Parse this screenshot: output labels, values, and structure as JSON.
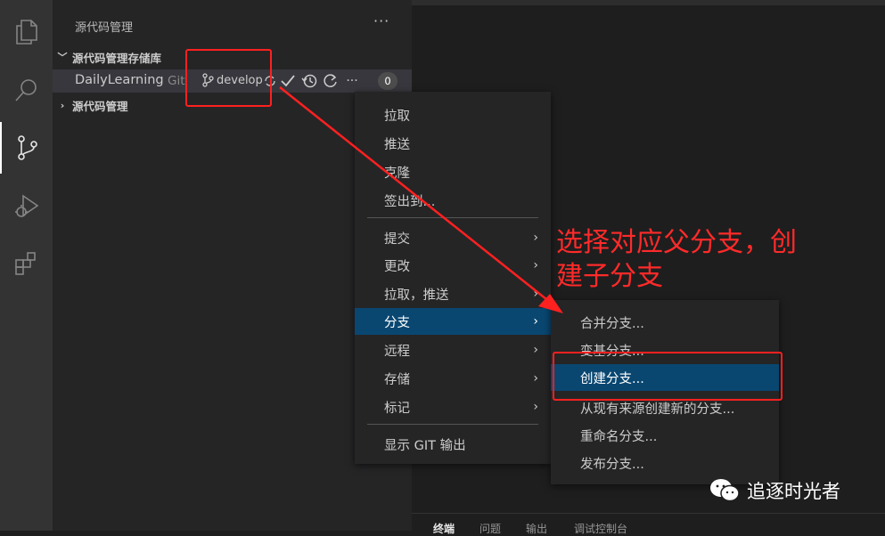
{
  "sidebar": {
    "title": "源代码管理",
    "more_label": "···",
    "section_repos": "源代码管理存储库",
    "section_scm": "源代码管理",
    "repo": {
      "name": "DailyLearning",
      "kind": "Git",
      "branch": "develop",
      "badge": "0",
      "actions_more": "···"
    }
  },
  "context_menu": {
    "items": [
      {
        "label": "拉取"
      },
      {
        "label": "推送"
      },
      {
        "label": "克隆"
      },
      {
        "label": "签出到..."
      },
      {
        "label": "提交",
        "submenu": true
      },
      {
        "label": "更改",
        "submenu": true
      },
      {
        "label": "拉取，推送",
        "submenu": true
      },
      {
        "label": "分支",
        "submenu": true,
        "highlighted": true
      },
      {
        "label": "远程",
        "submenu": true
      },
      {
        "label": "存储",
        "submenu": true
      },
      {
        "label": "标记",
        "submenu": true
      },
      {
        "label": "显示 GIT 输出"
      }
    ],
    "submenu_arrow": "›"
  },
  "branch_submenu": {
    "items": [
      {
        "label": "合并分支..."
      },
      {
        "label": "变基分支..."
      },
      {
        "label": "创建分支...",
        "highlighted": true
      },
      {
        "label": "从现有来源创建新的分支..."
      },
      {
        "label": "重命名分支..."
      },
      {
        "label": "发布分支..."
      }
    ]
  },
  "annotation": {
    "line1": "选择对应父分支，创",
    "line2": "建子分支"
  },
  "panel_tabs": [
    "终端",
    "问题",
    "输出",
    "调试控制台"
  ],
  "watermark": "追逐时光者",
  "colors": {
    "highlight": "#094771",
    "annotation_red": "#ff2a2a",
    "activity_bar": "#333333",
    "sidebar": "#252526"
  },
  "icons": [
    "explorer-icon",
    "search-icon",
    "source-control-icon",
    "run-debug-icon",
    "extensions-icon",
    "branch-icon",
    "sync-icon",
    "check-icon",
    "history-icon",
    "refresh-icon",
    "wechat-icon"
  ]
}
